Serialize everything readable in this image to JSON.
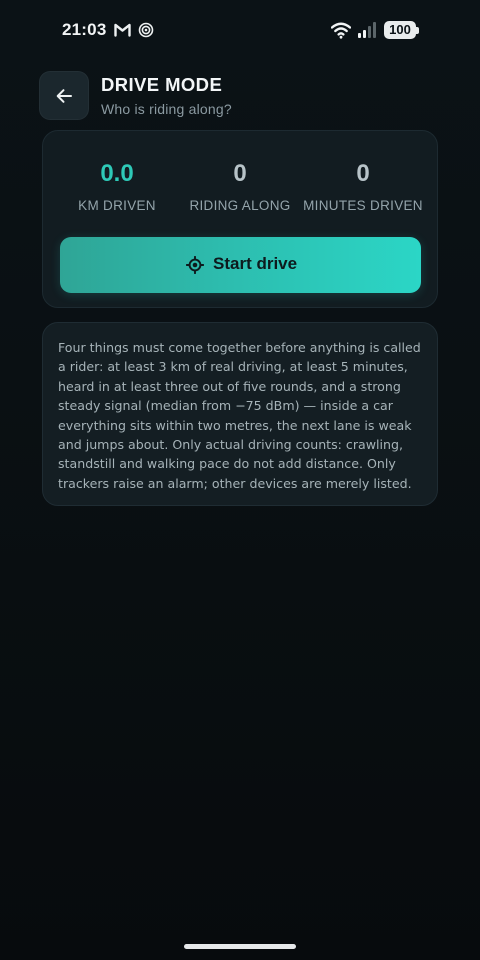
{
  "status_bar": {
    "time": "21:03",
    "battery": "100",
    "icons": [
      "gmail-icon",
      "sync-icon",
      "wifi-icon",
      "signal-icon",
      "battery-icon"
    ]
  },
  "header": {
    "back_icon": "arrow-left-icon",
    "title": "DRIVE MODE",
    "subtitle": "Who is riding along?"
  },
  "stats": [
    {
      "value": "0.0",
      "label": "KM DRIVEN"
    },
    {
      "value": "0",
      "label": "RIDING ALONG"
    },
    {
      "value": "0",
      "label": "MINUTES DRIVEN"
    }
  ],
  "start_button": {
    "icon": "location-target-icon",
    "label": "Start drive"
  },
  "info": {
    "text": "Four things must come together before anything is called a rider: at least 3 km of real driving, at least 5 minutes, heard in at least three out of five rounds, and a strong steady signal (median from −75 dBm) — inside a car everything sits within two metres, the next lane is weak and jumps about. Only actual driving counts: crawling, standstill and walking pace do not add distance. Only trackers raise an alarm; other devices are merely listed."
  },
  "colors": {
    "accent": "#2ec9b7",
    "background": "#0a1013",
    "card": "#121c21",
    "button_gradient_start": "#2fa596",
    "button_gradient_end": "#2bd6c6"
  }
}
